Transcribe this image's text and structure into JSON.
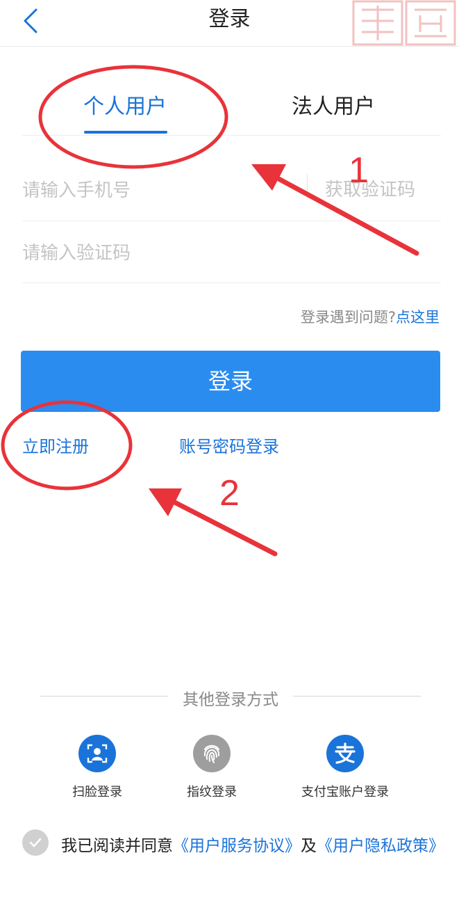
{
  "header": {
    "title": "登录"
  },
  "tabs": [
    {
      "label": "个人用户",
      "active": true
    },
    {
      "label": "法人用户",
      "active": false
    }
  ],
  "form": {
    "phone_placeholder": "请输入手机号",
    "get_code_label": "获取验证码",
    "code_placeholder": "请输入验证码",
    "help_text": "登录遇到问题?",
    "help_link": "点这里",
    "login_button": "登录",
    "register_link": "立即注册",
    "password_login_link": "账号密码登录"
  },
  "annotations": {
    "label_1": "1",
    "label_2": "2"
  },
  "other_login": {
    "title": "其他登录方式",
    "methods": [
      {
        "label": "扫脸登录",
        "icon": "face-scan-icon",
        "color": "#1a73d9"
      },
      {
        "label": "指纹登录",
        "icon": "fingerprint-icon",
        "color": "#9e9e9e"
      },
      {
        "label": "支付宝账户登录",
        "icon": "alipay-icon",
        "color": "#1a73d9"
      }
    ]
  },
  "agreement": {
    "prefix": "我已阅读并同意",
    "service_link": "《用户服务协议》",
    "and": "及",
    "privacy_link": "《用户隐私政策》"
  },
  "colors": {
    "accent": "#1a73d9",
    "button": "#2b8cf0",
    "annotation": "#e8333a"
  }
}
